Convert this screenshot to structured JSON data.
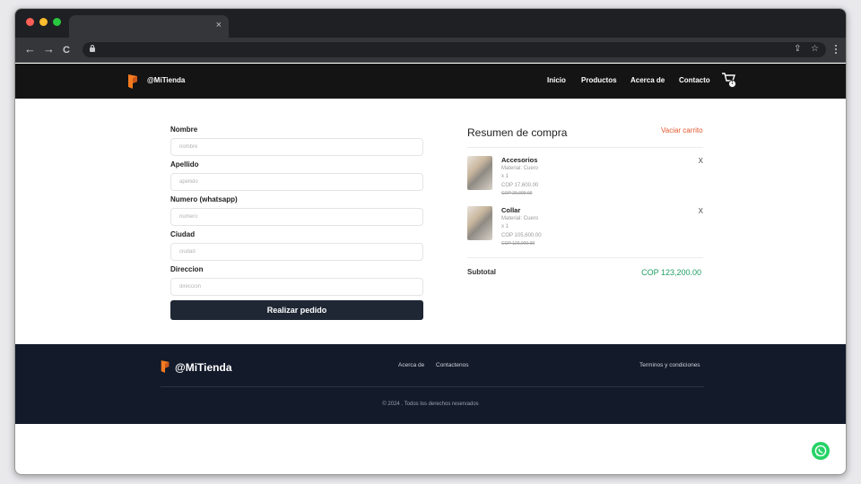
{
  "browser": {
    "tab_close": "×",
    "nav": {
      "back": "←",
      "forward": "→",
      "reload": "C"
    },
    "omnibox_icons": {
      "share": "⇪",
      "star": "☆"
    },
    "traffic_light_colors": [
      "#ff5f57",
      "#febc2e",
      "#28c840"
    ]
  },
  "header": {
    "brand": "@MiTienda",
    "nav": [
      "Inicio",
      "Productos",
      "Acerca de",
      "Contacto"
    ],
    "cart_count": "1"
  },
  "form": {
    "fields": [
      {
        "label": "Nombre",
        "placeholder": "nombre"
      },
      {
        "label": "Apellido",
        "placeholder": "apellido"
      },
      {
        "label": "Numero (whatsapp)",
        "placeholder": "numero"
      },
      {
        "label": "Ciudad",
        "placeholder": "ciudad"
      },
      {
        "label": "Direccion",
        "placeholder": "direccion"
      }
    ],
    "submit_label": "Realizar pedido"
  },
  "summary": {
    "title": "Resumen de compra",
    "clear_label": "Vaciar carrito",
    "items": [
      {
        "name": "Accesorios",
        "material": "Material: Cuero",
        "qty": "x 1",
        "price": "COP 17,600.00",
        "old_price": "COP 20,000.00",
        "remove": "X"
      },
      {
        "name": "Collar",
        "material": "Material: Cuero",
        "qty": "x 1",
        "price": "COP 105,600.00",
        "old_price": "COP 120,000.00",
        "remove": "X"
      }
    ],
    "subtotal_label": "Subtotal",
    "subtotal_value": "COP 123,200.00"
  },
  "footer": {
    "brand": "@MiTienda",
    "links": [
      "Acerca de",
      "Contactenos"
    ],
    "terms": "Terminos y condiciones",
    "copyright": "© 2024 . Todos los derechos reservados"
  },
  "colors": {
    "accent_orange": "#e4572e",
    "logo_orange": "#f47b20",
    "subtotal_green": "#1e9e62",
    "footer_bg": "#131a2a",
    "button_bg": "#1f2735",
    "whatsapp_green": "#25d366"
  },
  "icons": [
    "lock-icon",
    "share-icon",
    "star-icon",
    "menu-icon",
    "logo-icon",
    "cart-icon",
    "whatsapp-icon"
  ]
}
